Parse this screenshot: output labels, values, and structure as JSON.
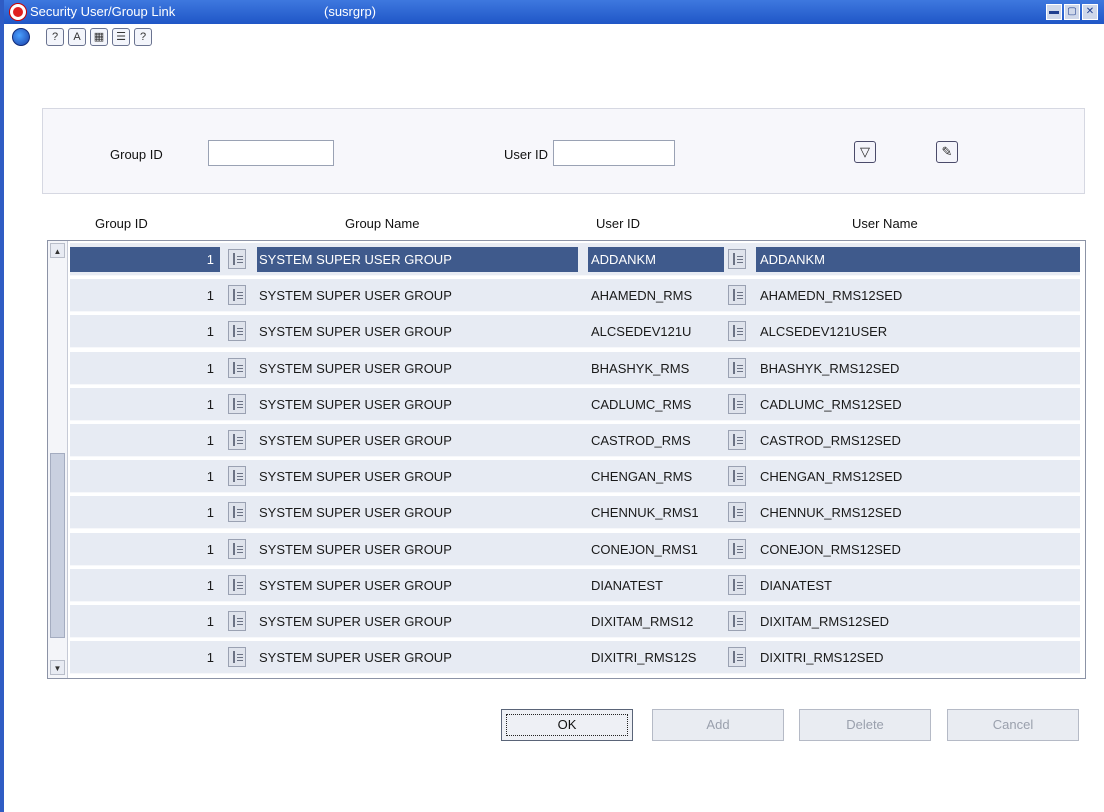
{
  "window": {
    "title": "Security User/Group Link",
    "code": "(susrgrp)",
    "controls": [
      "minimize",
      "maximize",
      "close"
    ]
  },
  "toolbar": {
    "icons": [
      "globe-icon",
      "help-icon",
      "spell-check-icon",
      "calendar-icon",
      "notes-icon",
      "question-icon"
    ]
  },
  "search": {
    "group_id_label": "Group ID",
    "group_id_value": "",
    "user_id_label": "User ID",
    "user_id_value": "",
    "filter_icon": "filter-icon",
    "clear_icon": "eraser-icon"
  },
  "table": {
    "columns": [
      "Group ID",
      "Group Name",
      "User ID",
      "User Name"
    ],
    "rows": [
      {
        "group_id": "1",
        "group_name": "SYSTEM SUPER USER GROUP",
        "user_id": "ADDANKM",
        "user_name": "ADDANKM",
        "selected": true
      },
      {
        "group_id": "1",
        "group_name": "SYSTEM SUPER USER GROUP",
        "user_id": "AHAMEDN_RMS",
        "user_name": "AHAMEDN_RMS12SED",
        "selected": false
      },
      {
        "group_id": "1",
        "group_name": "SYSTEM SUPER USER GROUP",
        "user_id": "ALCSEDEV121U",
        "user_name": "ALCSEDEV121USER",
        "selected": false
      },
      {
        "group_id": "1",
        "group_name": "SYSTEM SUPER USER GROUP",
        "user_id": "BHASHYK_RMS",
        "user_name": "BHASHYK_RMS12SED",
        "selected": false
      },
      {
        "group_id": "1",
        "group_name": "SYSTEM SUPER USER GROUP",
        "user_id": "CADLUMC_RMS",
        "user_name": "CADLUMC_RMS12SED",
        "selected": false
      },
      {
        "group_id": "1",
        "group_name": "SYSTEM SUPER USER GROUP",
        "user_id": "CASTROD_RMS",
        "user_name": "CASTROD_RMS12SED",
        "selected": false
      },
      {
        "group_id": "1",
        "group_name": "SYSTEM SUPER USER GROUP",
        "user_id": "CHENGAN_RMS",
        "user_name": "CHENGAN_RMS12SED",
        "selected": false
      },
      {
        "group_id": "1",
        "group_name": "SYSTEM SUPER USER GROUP",
        "user_id": "CHENNUK_RMS1",
        "user_name": "CHENNUK_RMS12SED",
        "selected": false
      },
      {
        "group_id": "1",
        "group_name": "SYSTEM SUPER USER GROUP",
        "user_id": "CONEJON_RMS1",
        "user_name": "CONEJON_RMS12SED",
        "selected": false
      },
      {
        "group_id": "1",
        "group_name": "SYSTEM SUPER USER GROUP",
        "user_id": "DIANATEST",
        "user_name": "DIANATEST",
        "selected": false
      },
      {
        "group_id": "1",
        "group_name": "SYSTEM SUPER USER GROUP",
        "user_id": "DIXITAM_RMS12",
        "user_name": "DIXITAM_RMS12SED",
        "selected": false
      },
      {
        "group_id": "1",
        "group_name": "SYSTEM SUPER USER GROUP",
        "user_id": "DIXITRI_RMS12S",
        "user_name": "DIXITRI_RMS12SED",
        "selected": false
      }
    ]
  },
  "buttons": {
    "ok": "OK",
    "add": "Add",
    "delete": "Delete",
    "cancel": "Cancel"
  },
  "colors": {
    "titlebar": "#1f56c6",
    "selected_row": "#3f5a8c",
    "row_background": "#e7ebf3"
  }
}
